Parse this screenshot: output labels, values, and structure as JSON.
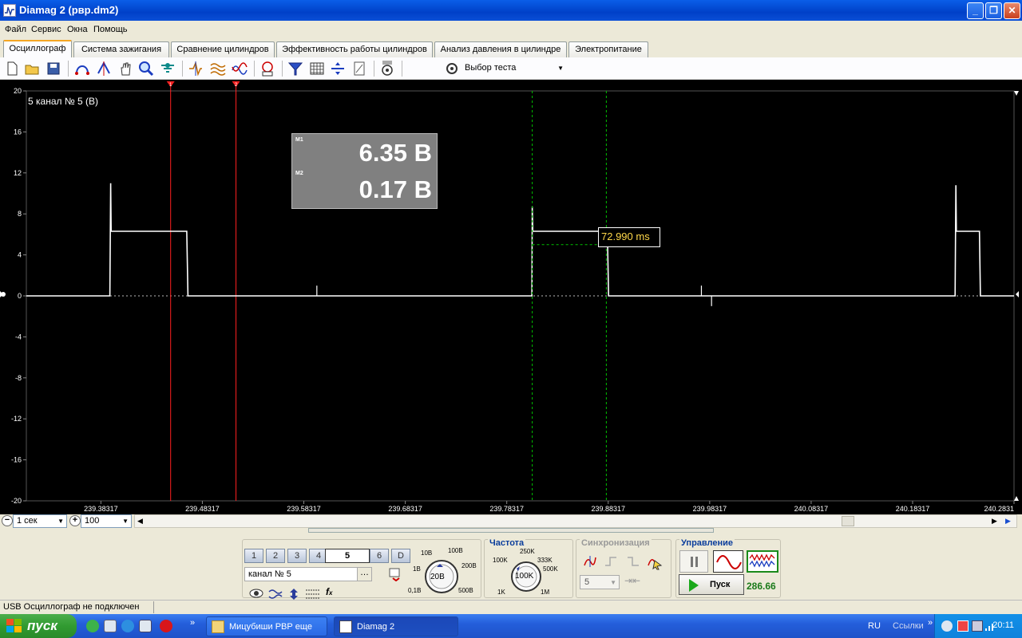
{
  "window": {
    "title": "Diamag 2 (рвр.dm2)",
    "minimize": "_",
    "maximize": "❐",
    "close": "✕"
  },
  "menu": [
    "Файл",
    "Сервис",
    "Окна",
    "Помощь"
  ],
  "tabs": [
    "Осциллограф",
    "Система зажигания",
    "Сравнение цилиндров",
    "Эффективность работы цилиндров",
    "Анализ давления в цилиндре",
    "Электропитание"
  ],
  "active_tab": 0,
  "toolbar": {
    "test_select_label": "Выбор теста"
  },
  "scope": {
    "channel_label": "5 канал № 5 (В)",
    "measure": {
      "m1_key": "M1",
      "m1_value": "6.35 В",
      "m2_key": "M2",
      "m2_value": "0.17 В"
    },
    "delta_time": "72.990 ms",
    "cursor_markers": [
      "1",
      "2"
    ],
    "colors": {
      "background": "#000000",
      "signal": "#ffffff",
      "cursor": "#ff0000",
      "dt_cursor": "#00c000",
      "delta_text": "#ffd84a"
    }
  },
  "chart_data": {
    "type": "line",
    "title": "5 канал № 5 (В)",
    "xlabel": "",
    "ylabel": "",
    "ylim": [
      -20,
      20
    ],
    "y_ticks": [
      "20",
      "16",
      "12",
      "8",
      "4",
      "0",
      "-4",
      "-8",
      "-12",
      "-16",
      "-20"
    ],
    "x_ticks": [
      "239.38317",
      "239.48317",
      "239.58317",
      "239.68317",
      "239.78317",
      "239.88317",
      "239.98317",
      "240.08317",
      "240.18317",
      "240.2831"
    ],
    "xlim": [
      239.3097,
      240.2831
    ],
    "grid": true,
    "series": [
      {
        "points": [
          [
            239.3097,
            0
          ],
          [
            239.392,
            0
          ],
          [
            239.3928,
            11
          ],
          [
            239.3933,
            6.3
          ],
          [
            239.4678,
            6.3
          ],
          [
            239.469,
            0
          ],
          [
            239.808,
            0
          ],
          [
            239.8083,
            8.7
          ],
          [
            239.8088,
            6.3
          ],
          [
            239.8823,
            6.3
          ],
          [
            239.8835,
            0
          ],
          [
            240.225,
            0
          ],
          [
            240.2258,
            10.8
          ],
          [
            240.2263,
            6.3
          ],
          [
            240.249,
            6.3
          ],
          [
            240.25,
            0
          ],
          [
            240.2831,
            0
          ]
        ]
      }
    ],
    "cursors_x": [
      239.4519,
      239.5163
    ],
    "dt_cursors_x": [
      239.8083,
      239.8813
    ]
  },
  "timescale": {
    "time_value": "1 сек",
    "zoom_value": "100"
  },
  "panel": {
    "channels": [
      "1",
      "2",
      "3",
      "4",
      "5",
      "6",
      "D"
    ],
    "active_channel": "5",
    "channel_name": "канал № 5",
    "voltage_knob": {
      "value": "20В",
      "labels": [
        "10В",
        "100В",
        "1В",
        "200В",
        "0,1В",
        "500В"
      ]
    },
    "frequency": {
      "title": "Частота",
      "value": "100K",
      "labels": [
        "250K",
        "100K",
        "333K",
        "500K",
        "1K",
        "1M"
      ]
    },
    "sync": {
      "title": "Синхронизация",
      "channel": "5"
    },
    "control": {
      "title": "Управление",
      "start_label": "Пуск",
      "counter": "286.66"
    }
  },
  "status": {
    "text": "USB Осциллограф не подключен"
  },
  "taskbar": {
    "start": "пуск",
    "tasks": [
      "Мицубиши РВР еще",
      "Diamag 2"
    ],
    "lang": "RU",
    "links": "Ссылки",
    "clock": "20:11"
  }
}
